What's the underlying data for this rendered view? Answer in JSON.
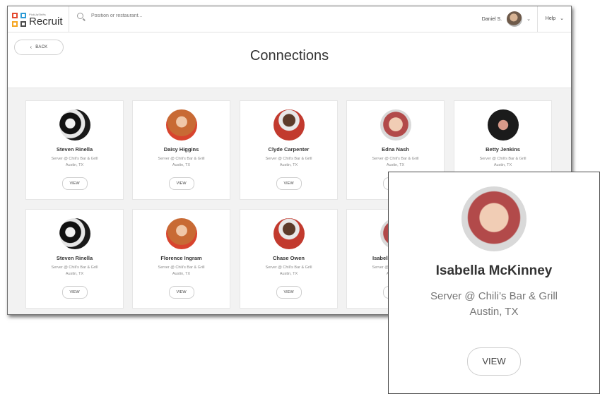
{
  "app": {
    "brand_small": "PickUpShifts",
    "brand_name": "Recruit"
  },
  "search": {
    "placeholder": "Position or restaurant..."
  },
  "user": {
    "name": "Daniel S."
  },
  "help": {
    "label": "Help"
  },
  "header": {
    "back_label": "BACK",
    "title": "Connections"
  },
  "cards": [
    {
      "name": "Steven Rinella",
      "role": "Server @ Chili's Bar & Grill",
      "location": "Austin, TX",
      "view": "VIEW",
      "avatar": "bw"
    },
    {
      "name": "Daisy Higgins",
      "role": "Server @ Chili's Bar & Grill",
      "location": "Austin, TX",
      "view": "VIEW",
      "avatar": "ginger"
    },
    {
      "name": "Clyde Carpenter",
      "role": "Server @ Chili's Bar & Grill",
      "location": "Austin, TX",
      "view": "VIEW",
      "avatar": "plaid"
    },
    {
      "name": "Edna Nash",
      "role": "Server @ Chili's Bar & Grill",
      "location": "Austin, TX",
      "view": "VIEW",
      "avatar": "redhead"
    },
    {
      "name": "Betty Jenkins",
      "role": "Server @ Chili's Bar & Grill",
      "location": "Austin, TX",
      "view": "VIEW",
      "avatar": "dark"
    },
    {
      "name": "Steven Rinella",
      "role": "Server @ Chili's Bar & Grill",
      "location": "Austin, TX",
      "view": "VIEW",
      "avatar": "bw"
    },
    {
      "name": "Florence Ingram",
      "role": "Server @ Chili's Bar & Grill",
      "location": "Austin, TX",
      "view": "VIEW",
      "avatar": "ginger"
    },
    {
      "name": "Chase Owen",
      "role": "Server @ Chili's Bar & Grill",
      "location": "Austin, TX",
      "view": "VIEW",
      "avatar": "plaid"
    },
    {
      "name": "Isabella McKinney",
      "role": "Server @ Chili's Bar & Grill",
      "location": "Austin, TX",
      "view": "VIEW",
      "avatar": "redhead"
    }
  ],
  "zoom_card": {
    "name": "Isabella McKinney",
    "role": "Server @ Chili’s Bar & Grill",
    "location": "Austin, TX",
    "view": "VIEW",
    "avatar": "redhead"
  }
}
